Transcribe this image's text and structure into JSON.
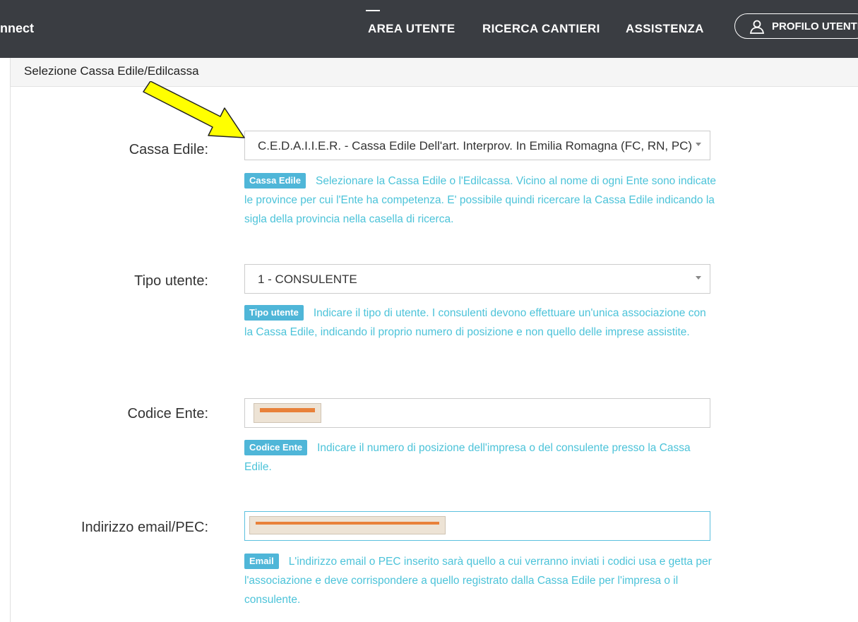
{
  "header": {
    "brand": "nnect",
    "nav": [
      "AREA UTENTE",
      "RICERCA CANTIERI",
      "ASSISTENZA"
    ],
    "profile_label": "PROFILO UTENTE",
    "background": "#3a3d42"
  },
  "panel": {
    "title": "Selezione Cassa Edile/Edilcassa"
  },
  "form": {
    "cassa": {
      "label": "Cassa Edile:",
      "value": "C.E.D.A.I.I.E.R. - Cassa Edile Dell'art. Interprov. In Emilia Romagna (FC, RN, PC)",
      "badge": "Cassa Edile",
      "help": "Selezionare la Cassa Edile o l'Edilcassa. Vicino al nome di ogni Ente sono indicate le province per cui l'Ente ha competenza. E' possibile quindi ricercare la Cassa Edile indicando la sigla della provincia nella casella di ricerca."
    },
    "tipo": {
      "label": "Tipo utente:",
      "value": "1 - CONSULENTE",
      "badge": "Tipo utente",
      "help": "Indicare il tipo di utente. I consulenti devono effettuare un'unica associazione con la Cassa Edile, indicando il proprio numero di posizione e non quello delle imprese assistite."
    },
    "codice": {
      "label": "Codice Ente:",
      "badge": "Codice Ente",
      "help": "Indicare il numero di posizione dell'impresa o del consulente presso la Cassa Edile."
    },
    "email": {
      "label": "Indirizzo email/PEC:",
      "badge": "Email",
      "help": "L'indirizzo email o PEC inserito sarà quello a cui verranno inviati i codici usa e getta per l'associazione e deve corrispondere a quello registrato dalla Cassa Edile per l'impresa o il consulente."
    }
  },
  "colors": {
    "help_text": "#4cc3d9",
    "badge": "#4fb6d8",
    "annotation_arrow": "#ffff00",
    "redaction": "#e8813a"
  },
  "icons": {
    "profile": "user-icon",
    "dropdown": "caret-down-icon",
    "annotation": "yellow-arrow-annotation"
  }
}
